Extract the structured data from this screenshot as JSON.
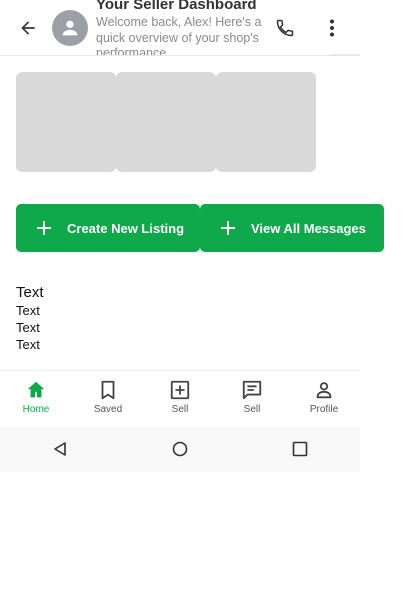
{
  "header": {
    "title": "Your Seller Dashboard",
    "subtitle": "Welcome back, Alex! Here's a quick overview of your shop's performance."
  },
  "actions": {
    "create_label": "Create New Listing",
    "messages_label": "View All Messages"
  },
  "texts": [
    "Text",
    "Text",
    "Text",
    "Text"
  ],
  "bottom_nav": {
    "items": [
      {
        "label": "Home",
        "icon": "home-icon",
        "active": true
      },
      {
        "label": "Saved",
        "icon": "bookmark-icon",
        "active": false
      },
      {
        "label": "Sell",
        "icon": "add-box-icon",
        "active": false
      },
      {
        "label": "Sell",
        "icon": "chat-icon",
        "active": false
      },
      {
        "label": "Profile",
        "icon": "person-icon",
        "active": false
      }
    ]
  },
  "colors": {
    "accent": "#0fa84a",
    "placeholder": "#d9d9d9",
    "avatar": "#9aa0a6"
  }
}
